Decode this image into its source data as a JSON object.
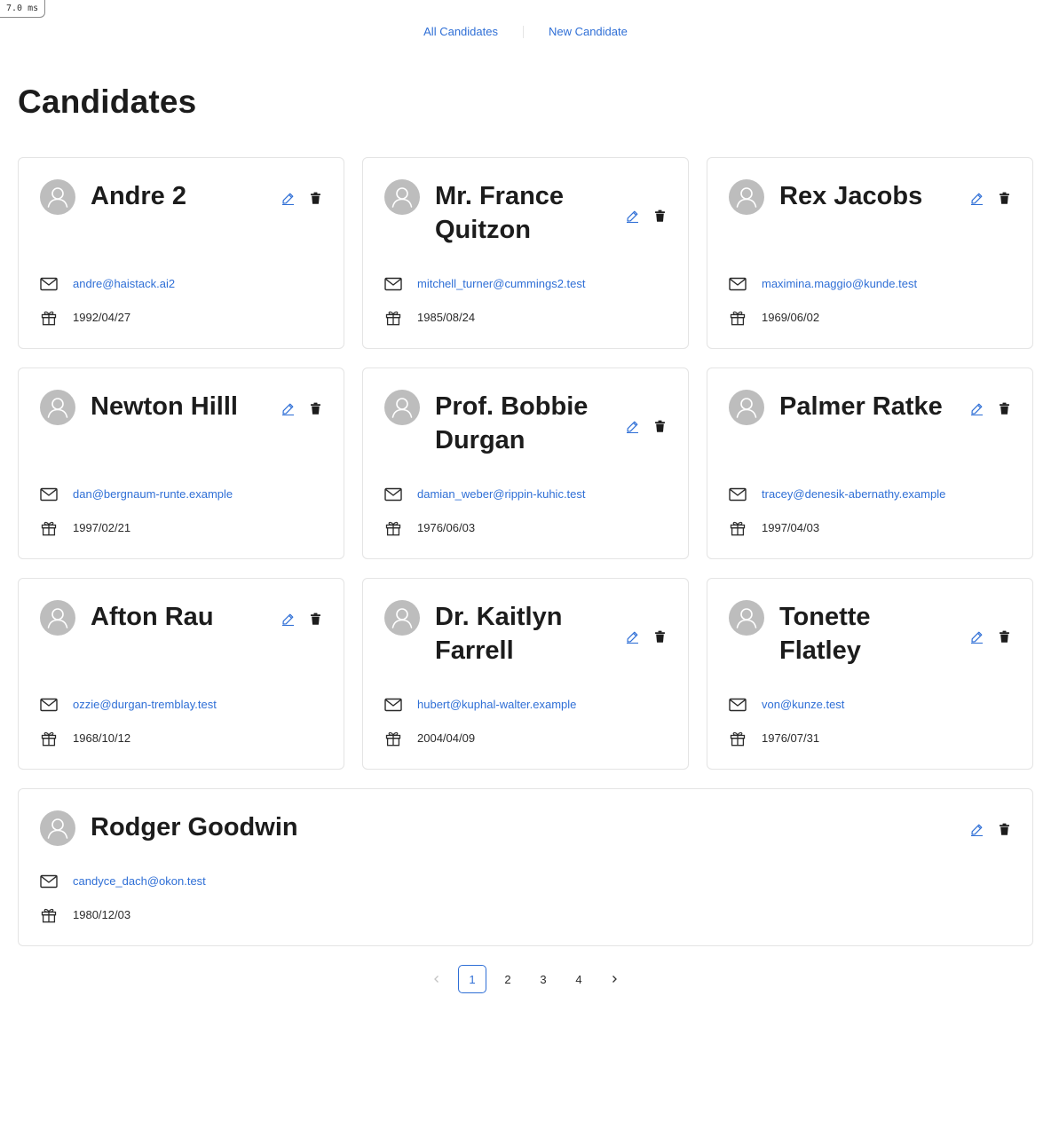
{
  "debug": {
    "render_time": "7.0 ms"
  },
  "nav": {
    "all_candidates": "All Candidates",
    "new_candidate": "New Candidate"
  },
  "page": {
    "title": "Candidates"
  },
  "candidates": [
    {
      "name": "Andre 2",
      "email": "andre@haistack.ai2",
      "dob": "1992/04/27"
    },
    {
      "name": "Mr. France Quitzon",
      "email": "mitchell_turner@cummings2.test",
      "dob": "1985/08/24"
    },
    {
      "name": "Rex Jacobs",
      "email": "maximina.maggio@kunde.test",
      "dob": "1969/06/02"
    },
    {
      "name": "Newton Hilll",
      "email": "dan@bergnaum-runte.example",
      "dob": "1997/02/21"
    },
    {
      "name": "Prof. Bobbie Durgan",
      "email": "damian_weber@rippin-kuhic.test",
      "dob": "1976/06/03"
    },
    {
      "name": "Palmer Ratke",
      "email": "tracey@denesik-abernathy.example",
      "dob": "1997/04/03"
    },
    {
      "name": "Afton Rau",
      "email": "ozzie@durgan-tremblay.test",
      "dob": "1968/10/12"
    },
    {
      "name": "Dr. Kaitlyn Farrell",
      "email": "hubert@kuphal-walter.example",
      "dob": "2004/04/09"
    },
    {
      "name": "Tonette Flatley",
      "email": "von@kunze.test",
      "dob": "1976/07/31"
    },
    {
      "name": "Rodger Goodwin",
      "email": "candyce_dach@okon.test",
      "dob": "1980/12/03"
    }
  ],
  "pagination": {
    "prev_icon": "chevron-left-icon",
    "next_icon": "chevron-right-icon",
    "pages": [
      "1",
      "2",
      "3",
      "4"
    ],
    "current": "1"
  },
  "icons": {
    "avatar": "user-icon",
    "edit": "pencil-icon",
    "delete": "trash-icon",
    "email": "mail-icon",
    "dob": "gift-icon"
  },
  "colors": {
    "link": "#2f6fd6",
    "avatar_bg": "#bdbdbd",
    "card_border": "#e4e4e4",
    "title": "#1c1c1c"
  }
}
